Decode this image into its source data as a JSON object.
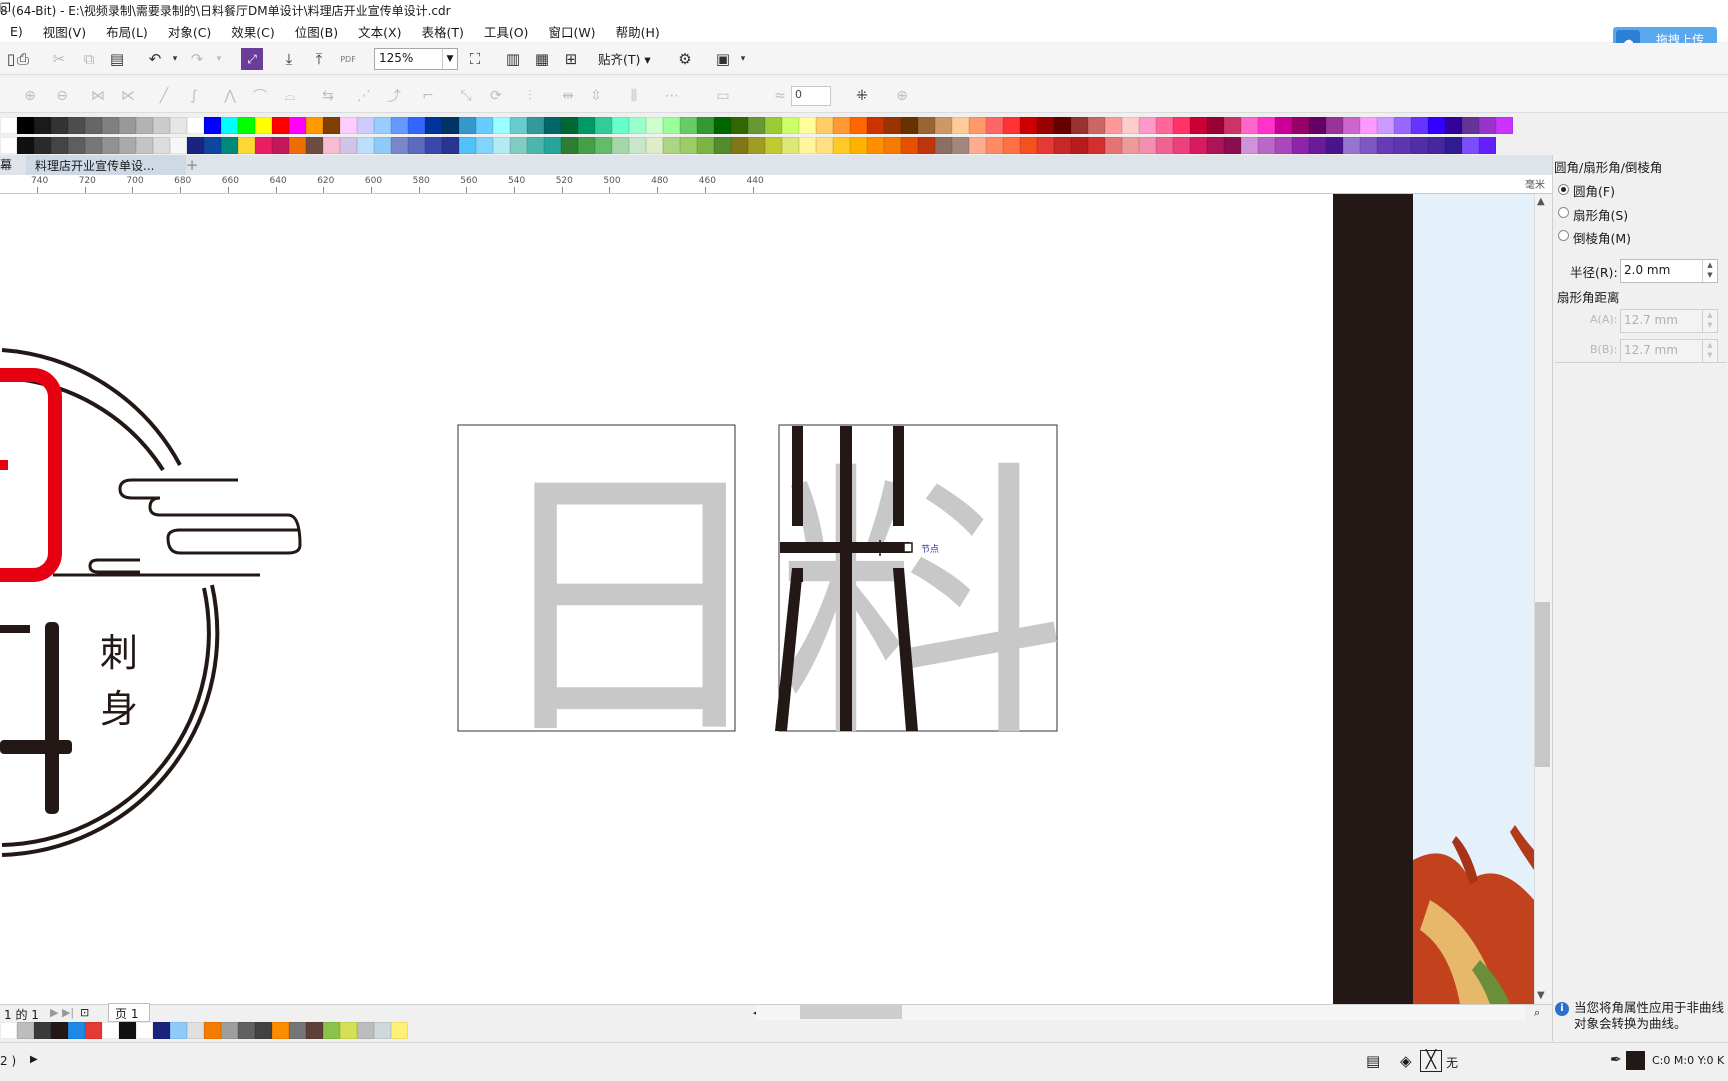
{
  "window": {
    "title": "8 (64-Bit) - E:\\视频录制\\需要录制的\\日料餐厅DM单设计\\料理店开业宣传单设计.cdr",
    "restore_glyph": "❐"
  },
  "menu": [
    "E)",
    "视图(V)",
    "布局(L)",
    "对象(C)",
    "效果(C)",
    "位图(B)",
    "文本(X)",
    "表格(T)",
    "工具(O)",
    "窗口(W)",
    "帮助(H)"
  ],
  "upload": {
    "label": "拖拽上传",
    "cloud_glyph": "☁"
  },
  "toolbar": {
    "zoom_value": "125%",
    "pdf_label": "PDF",
    "snap_label": "贴齐(T)",
    "icons": {
      "print": "⎙",
      "cut": "✂",
      "copy": "⧉",
      "paste": "📋",
      "undo": "↶",
      "redo": "↷",
      "import": "⤓",
      "export": "⤒",
      "fullscreen": "⛶",
      "settings": "⚙",
      "dropdown": "▾"
    }
  },
  "propbar": {
    "node_count": "0"
  },
  "palette_row1": [
    "#ffffff",
    "#000000",
    "#1a1a1a",
    "#333333",
    "#4d4d4d",
    "#666666",
    "#808080",
    "#999999",
    "#b3b3b3",
    "#cccccc",
    "#e6e6e6",
    "#ffffff",
    "#0000ff",
    "#00ffff",
    "#00ff00",
    "#ffff00",
    "#ff0000",
    "#ff00ff",
    "#ff9900",
    "#7f3f00",
    "#ffccff",
    "#ccccff",
    "#99ccff",
    "#6699ff",
    "#3366ff",
    "#003399",
    "#003366",
    "#3399cc",
    "#66ccff",
    "#99ffff",
    "#66cccc",
    "#339999",
    "#006666",
    "#006633",
    "#009966",
    "#33cc99",
    "#66ffcc",
    "#99ffcc",
    "#ccffcc",
    "#99ff99",
    "#66cc66",
    "#339933",
    "#006600",
    "#336600",
    "#669933",
    "#99cc33",
    "#ccff66",
    "#ffff99",
    "#ffcc66",
    "#ff9933",
    "#ff6600",
    "#cc3300",
    "#993300",
    "#663300",
    "#996633",
    "#cc9966",
    "#ffcc99",
    "#ff9966",
    "#ff6666",
    "#ff3333",
    "#cc0000",
    "#990000",
    "#660000",
    "#993333",
    "#cc6666",
    "#ff9999",
    "#ffcccc",
    "#ff99cc",
    "#ff6699",
    "#ff3366",
    "#cc0033",
    "#990033",
    "#cc3366",
    "#ff66cc",
    "#ff33cc",
    "#cc0099",
    "#990066",
    "#660066",
    "#993399",
    "#cc66cc",
    "#ff99ff",
    "#cc99ff",
    "#9966ff",
    "#6633ff",
    "#3300ff",
    "#330099",
    "#663399",
    "#9933cc",
    "#cc33ff"
  ],
  "palette_row2": [
    "#ffffff",
    "#111111",
    "#2b2b2b",
    "#444444",
    "#5e5e5e",
    "#777777",
    "#919191",
    "#aaaaaa",
    "#c4c4c4",
    "#dddddd",
    "#f7f7f7",
    "#1a237e",
    "#0d47a1",
    "#00897b",
    "#fdd835",
    "#e91e63",
    "#c2185b",
    "#ef6c00",
    "#6d4c41",
    "#f8bbd0",
    "#d1c4e9",
    "#bbdefb",
    "#90caf9",
    "#7986cb",
    "#5c6bc0",
    "#3949ab",
    "#283593",
    "#4fc3f7",
    "#81d4fa",
    "#b2ebf2",
    "#80cbc4",
    "#4db6ac",
    "#26a69a",
    "#2e7d32",
    "#43a047",
    "#66bb6a",
    "#a5d6a7",
    "#c8e6c9",
    "#dcedc8",
    "#aed581",
    "#9ccc65",
    "#7cb342",
    "#558b2f",
    "#827717",
    "#9e9d24",
    "#c0ca33",
    "#dce775",
    "#fff59d",
    "#ffe082",
    "#ffca28",
    "#ffb300",
    "#ff8f00",
    "#f57c00",
    "#e65100",
    "#bf360c",
    "#8d6e63",
    "#a1887f",
    "#ffab91",
    "#ff8a65",
    "#ff7043",
    "#f4511e",
    "#e53935",
    "#c62828",
    "#b71c1c",
    "#d32f2f",
    "#e57373",
    "#ef9a9a",
    "#f48fb1",
    "#f06292",
    "#ec407a",
    "#d81b60",
    "#ad1457",
    "#880e4f",
    "#ce93d8",
    "#ba68c8",
    "#ab47bc",
    "#8e24aa",
    "#6a1b9a",
    "#4a148c",
    "#9575cd",
    "#7e57c2",
    "#673ab7",
    "#5e35b1",
    "#512da8",
    "#4527a0",
    "#311b92",
    "#7c4dff",
    "#651fff"
  ],
  "doc_tabs": {
    "left_fragment": "幕",
    "active": "料理店开业宣传单设...",
    "add_glyph": "+"
  },
  "ruler": {
    "unit": "毫米",
    "ticks": [
      "740",
      "720",
      "700",
      "680",
      "660",
      "640",
      "620",
      "600",
      "580",
      "560",
      "540",
      "520",
      "500",
      "480",
      "460",
      "440"
    ]
  },
  "canvas": {
    "logo_chars": [
      "刺",
      "身"
    ],
    "glyph_ri": "日",
    "glyph_liao": "料",
    "node_label": "节点"
  },
  "page_nav": {
    "info": "1 的 1",
    "page_tab": "页 1"
  },
  "doc_palette": [
    "#ffffff",
    "#bdbdbd",
    "#3a3a3a",
    "#231815",
    "#1e88e5",
    "#e53935",
    "#ffffff",
    "#111111",
    "#ffffff",
    "#1a237e",
    "#90caf9",
    "#e0e0e0",
    "#f57c00",
    "#9e9e9e",
    "#616161",
    "#424242",
    "#fb8c00",
    "#757575",
    "#5d4037",
    "#8bc34a",
    "#d4e157",
    "#bdbdbd",
    "#cfd8dc",
    "#fff176"
  ],
  "status": {
    "left": "2 )",
    "fill_none": "无",
    "outline_readout": "C:0 M:0 Y:0 K"
  },
  "docker": {
    "title": "圆角/扇形角/倒棱角",
    "options": [
      {
        "label": "圆角(F)",
        "selected": true
      },
      {
        "label": "扇形角(S)",
        "selected": false
      },
      {
        "label": "倒棱角(M)",
        "selected": false
      }
    ],
    "radius_label": "半径(R):",
    "radius_value": "2.0 mm",
    "scallop_title": "扇形角距离",
    "a_label": "A(A):",
    "a_value": "12.7 mm",
    "b_label": "B(B):",
    "b_value": "12.7 mm",
    "info_line1": "当您将角属性应用于非曲线",
    "info_line2": "对象会转换为曲线。"
  }
}
